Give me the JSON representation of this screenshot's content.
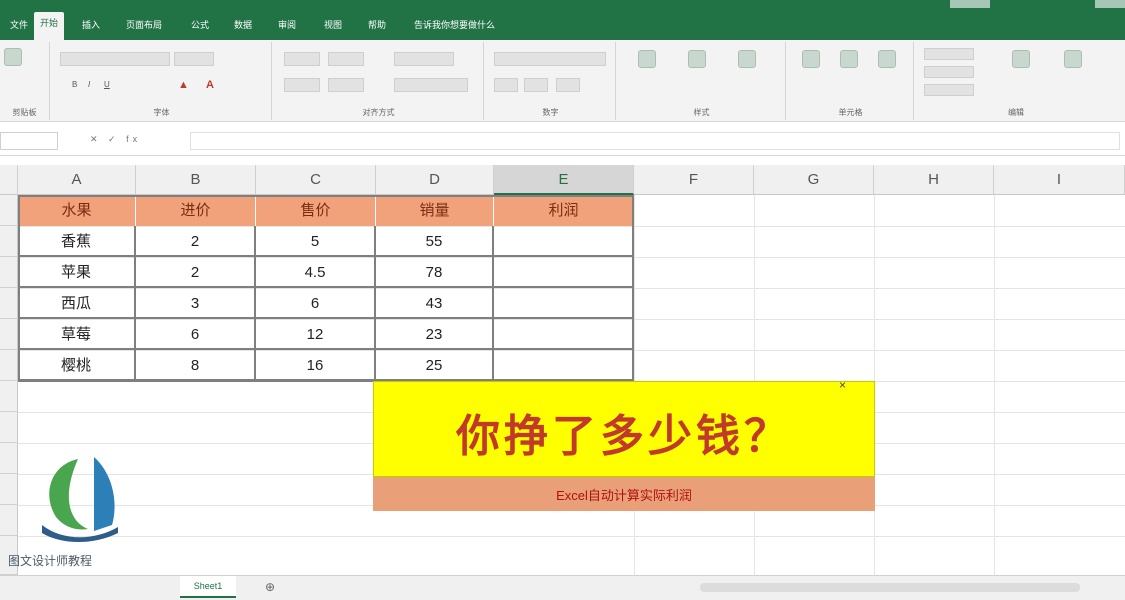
{
  "ribbon_tabs": [
    "文件",
    "开始",
    "插入",
    "页面布局",
    "公式",
    "数据",
    "审阅",
    "视图",
    "帮助",
    "告诉我你想要做什么"
  ],
  "ribbon_groups": [
    "剪贴板",
    "字体",
    "对齐方式",
    "数字",
    "样式",
    "单元格",
    "编辑"
  ],
  "formula_bar": {
    "name_box": "",
    "fx": "✕ ✓ fx",
    "value": ""
  },
  "columns": [
    "A",
    "B",
    "C",
    "D",
    "E",
    "F",
    "G",
    "H",
    "I"
  ],
  "selected_column": "E",
  "table": {
    "headers": [
      "水果",
      "进价",
      "售价",
      "销量",
      "利润"
    ],
    "rows": [
      [
        "香蕉",
        "2",
        "5",
        "55",
        ""
      ],
      [
        "苹果",
        "2",
        "4.5",
        "78",
        ""
      ],
      [
        "西瓜",
        "3",
        "6",
        "43",
        ""
      ],
      [
        "草莓",
        "6",
        "12",
        "23",
        ""
      ],
      [
        "樱桃",
        "8",
        "16",
        "25",
        ""
      ]
    ]
  },
  "banner": {
    "title": "你挣了多少钱？",
    "subtitle": "Excel自动计算实际利润",
    "close": "×"
  },
  "logo": {
    "text": "图文设计师教程"
  },
  "sheet_tab": "Sheet1",
  "add_sheet": "⊕",
  "colors": {
    "excel_green": "#217346",
    "header_fill": "#f2a27a",
    "banner_fill": "#ffff00",
    "banner_text": "#c0392b"
  }
}
